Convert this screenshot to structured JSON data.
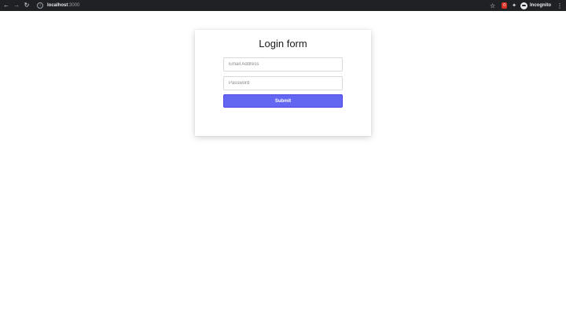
{
  "browser": {
    "url_host": "localhost",
    "url_port": ":3000",
    "profile_label": "Incognito",
    "extension_badge": "0"
  },
  "login": {
    "title": "Login form",
    "email_placeholder": "Email Address",
    "password_placeholder": "Password",
    "submit_label": "Submit"
  },
  "colors": {
    "submit_bg": "#6366f1",
    "browser_bar": "#202124"
  },
  "icons": [
    "back-arrow-icon",
    "forward-arrow-icon",
    "reload-icon",
    "info-icon",
    "star-icon",
    "extension-icon",
    "puzzle-icon",
    "incognito-icon",
    "menu-dots-icon"
  ]
}
